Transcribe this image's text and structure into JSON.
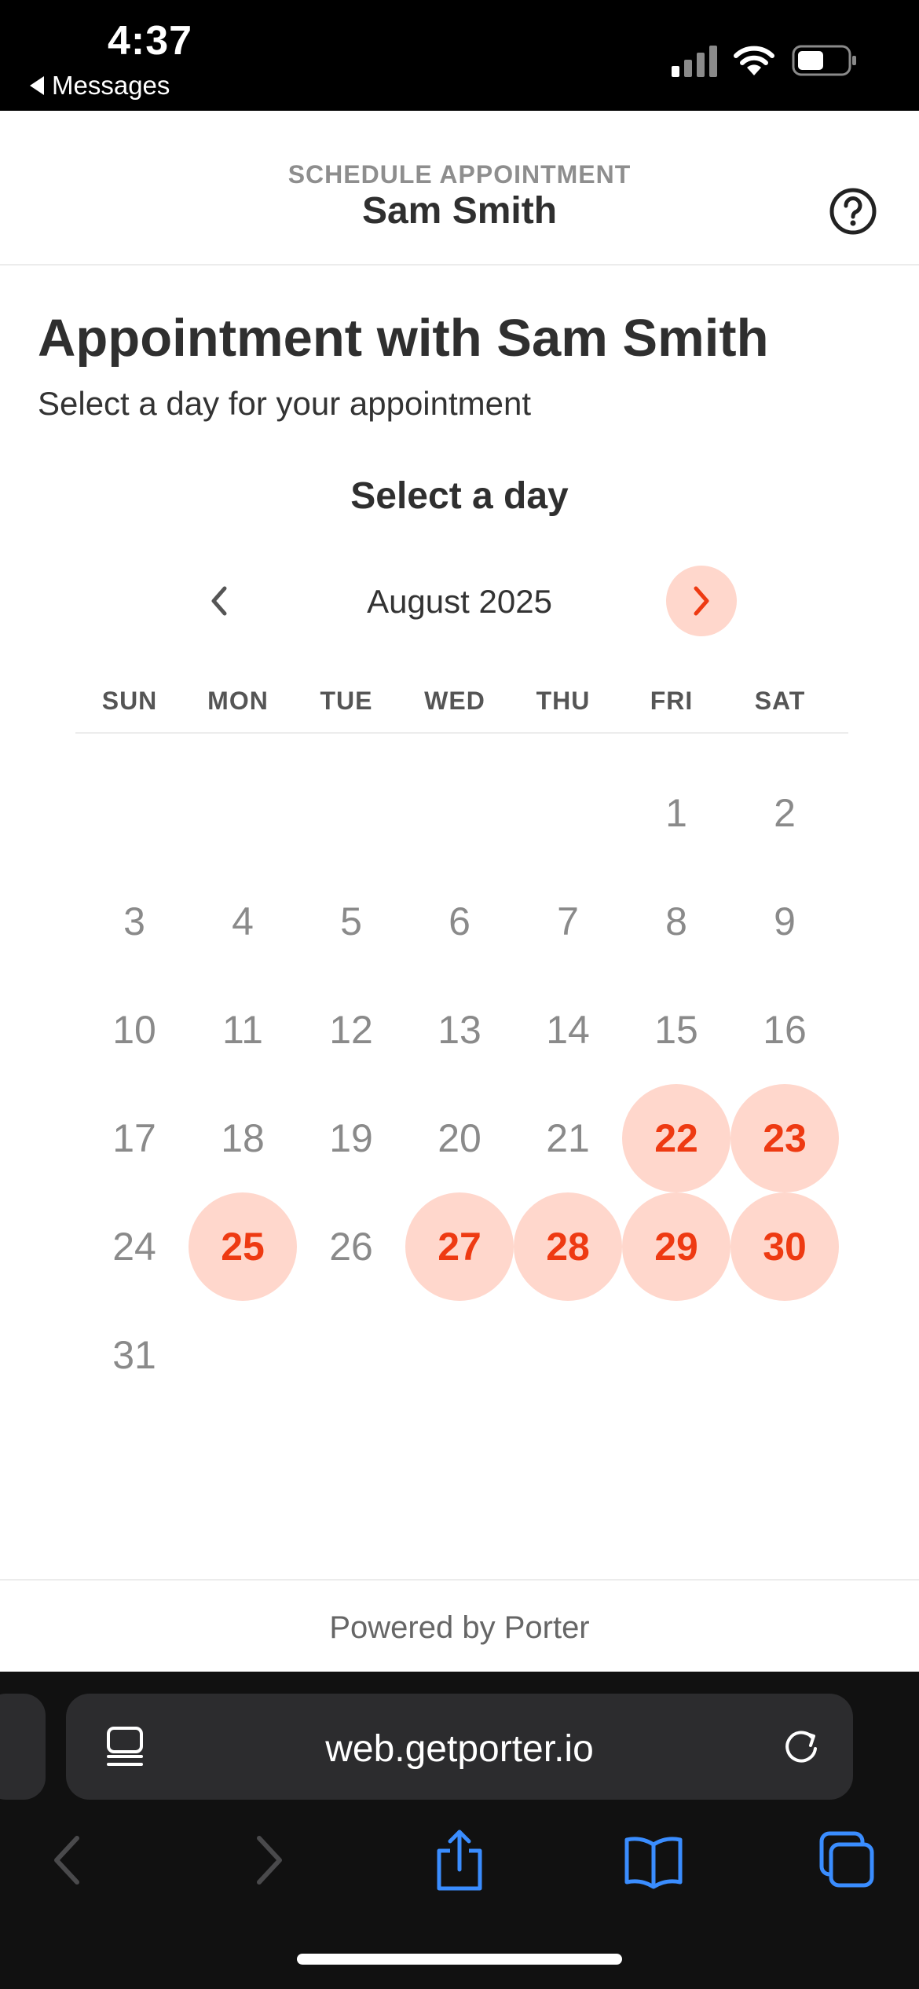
{
  "status_bar": {
    "time": "4:37",
    "back_label": "Messages"
  },
  "header": {
    "eyebrow": "SCHEDULE APPOINTMENT",
    "name": "Sam Smith",
    "help_icon": "question-circle-icon"
  },
  "page": {
    "title": "Appointment with Sam Smith",
    "subtitle": "Select a day for your appointment",
    "select_title": "Select a day"
  },
  "calendar": {
    "month_label": "August 2025",
    "weekdays": [
      "SUN",
      "MON",
      "TUE",
      "WED",
      "THU",
      "FRI",
      "SAT"
    ],
    "first_weekday_index": 5,
    "days_in_month": 31,
    "available_days": [
      22,
      23,
      25,
      27,
      28,
      29,
      30
    ],
    "colors": {
      "available_bg": "#ffd7cc",
      "available_text": "#ee3a12",
      "unavailable_text": "#8a8a8a",
      "nav_active_bg": "#ffd7cc"
    }
  },
  "footer": {
    "text": "Powered by Porter"
  },
  "browser": {
    "url": "web.getporter.io",
    "icons": {
      "reader": "page-menu-icon",
      "reload": "reload-icon",
      "back": "back-chevron-icon",
      "forward": "forward-chevron-icon",
      "share": "share-icon",
      "bookmarks": "book-icon",
      "tabs": "tabs-icon"
    }
  }
}
